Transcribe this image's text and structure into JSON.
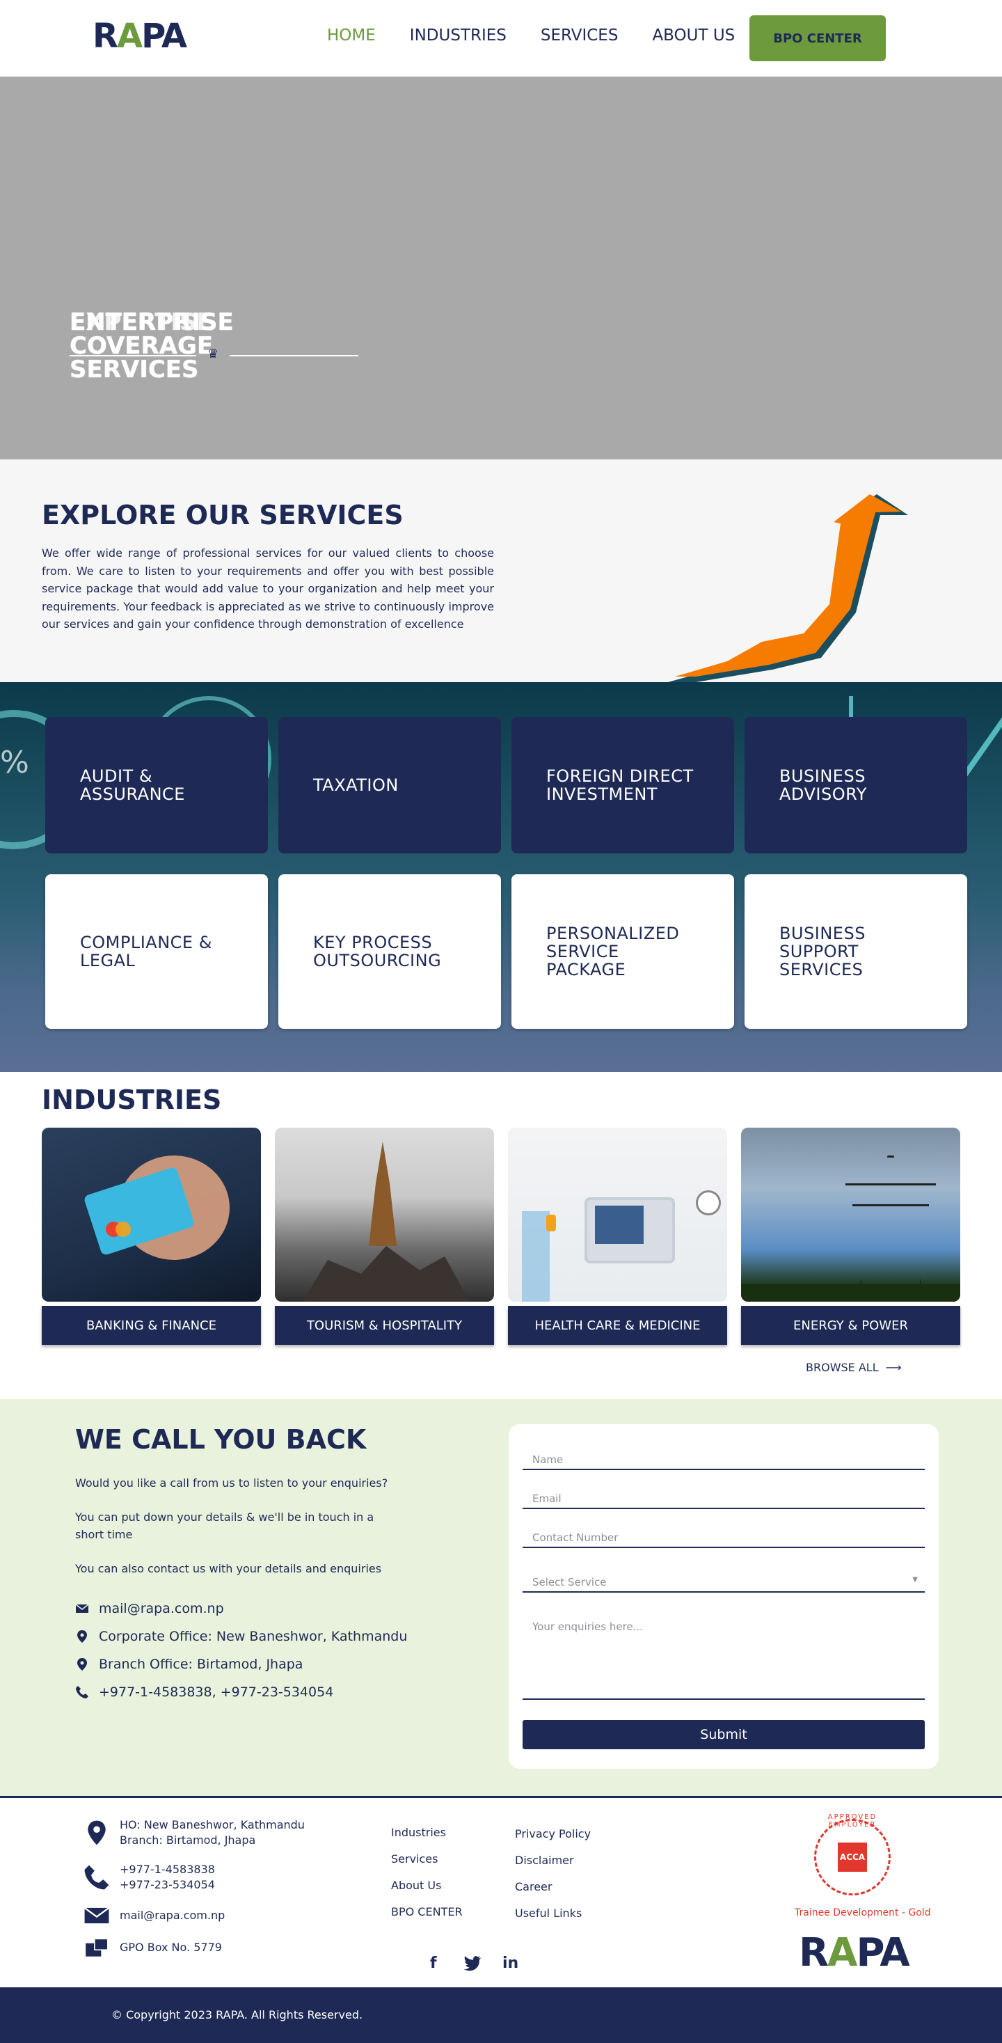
{
  "nav": {
    "logo": "RAPA",
    "logo_accent": "A",
    "items": [
      {
        "label": "HOME",
        "active": true
      },
      {
        "label": "INDUSTRIES",
        "active": false
      },
      {
        "label": "SERVICES",
        "active": false
      },
      {
        "label": "ABOUT US",
        "active": false
      }
    ],
    "cta": "BPO CENTER"
  },
  "hero": {
    "title_line1": "ENTERPRISE COVERAGE",
    "title_line2": "SERVICES",
    "overlay_text": "EXPERTISE"
  },
  "explore": {
    "heading": "EXPLORE OUR SERVICES",
    "body": "We offer wide range of professional services for our valued clients to choose from. We care to listen to your requirements and offer you with best possible service package that would add value to your organization and help meet your requirements. Your feedback is appreciated as we strive to continuously improve our services and gain your confidence through demonstration of excellence"
  },
  "services": [
    {
      "label_1": "AUDIT &",
      "label_2": "ASSURANCE",
      "label_3": ""
    },
    {
      "label_1": "TAXATION",
      "label_2": "",
      "label_3": ""
    },
    {
      "label_1": "FOREIGN DIRECT",
      "label_2": "INVESTMENT",
      "label_3": ""
    },
    {
      "label_1": "BUSINESS",
      "label_2": "ADVISORY",
      "label_3": ""
    },
    {
      "label_1": "COMPLIANCE &",
      "label_2": "LEGAL",
      "label_3": ""
    },
    {
      "label_1": "KEY PROCESS",
      "label_2": "OUTSOURCING",
      "label_3": ""
    },
    {
      "label_1": "PERSONALIZED",
      "label_2": "SERVICE",
      "label_3": "PACKAGE"
    },
    {
      "label_1": "BUSINESS",
      "label_2": "SUPPORT",
      "label_3": "SERVICES"
    }
  ],
  "industries": {
    "heading": "INDUSTRIES",
    "items": [
      {
        "label": "BANKING & FINANCE",
        "icon": "credit-card-image"
      },
      {
        "label": "TOURISM & HOSPITALITY",
        "icon": "temple-image"
      },
      {
        "label": "HEALTH CARE & MEDICINE",
        "icon": "medical-monitor-image"
      },
      {
        "label": "ENERGY & POWER",
        "icon": "power-tower-image"
      }
    ],
    "browse_all": "BROWSE ALL"
  },
  "callback": {
    "heading": "WE CALL YOU BACK",
    "text_1": "Would you like a call from us to listen to your enquiries?",
    "text_2": "You can put down your details & we'll be in touch in a short time",
    "text_3": "You can also contact us with your details and enquiries",
    "email": "mail@rapa.com.np",
    "corporate": "Corporate Office: New Baneshwor, Kathmandu",
    "branch": "Branch Office: Birtamod, Jhapa",
    "phone": "+977-1-4583838, +977-23-534054",
    "form": {
      "name_placeholder": "Name",
      "email_placeholder": "Email",
      "contact_placeholder": "Contact Number",
      "service_placeholder": "Select Service",
      "enquiry_placeholder": "Your enquiries here...",
      "submit": "Submit"
    }
  },
  "footer": {
    "ho": "HO: New Baneshwor, Kathmandu",
    "branch": "Branch: Birtamod, Jhapa",
    "phone_1": "+977-1-4583838",
    "phone_2": "+977-23-534054",
    "email": "mail@rapa.com.np",
    "po_box": "GPO Box No. 5779",
    "links_col1": [
      "Industries",
      "Services",
      "About Us",
      "BPO CENTER"
    ],
    "links_col2": [
      "Privacy Policy",
      "Disclaimer",
      "Career",
      "Useful Links"
    ],
    "social": [
      "facebook-icon",
      "twitter-icon",
      "linkedin-icon"
    ],
    "acca_badge": "ACCA",
    "acca_ring": "APPROVED EMPLOYER",
    "acca_tag": "Trainee Development - Gold",
    "logo": "RAPA",
    "copyright": "© Copyright 2023 RAPA. All Rights Reserved."
  },
  "colors": {
    "primary": "#1e2a55",
    "accent": "#6c9a3d",
    "callback_bg": "#e9f2dc",
    "acca_red": "#e2372d"
  }
}
